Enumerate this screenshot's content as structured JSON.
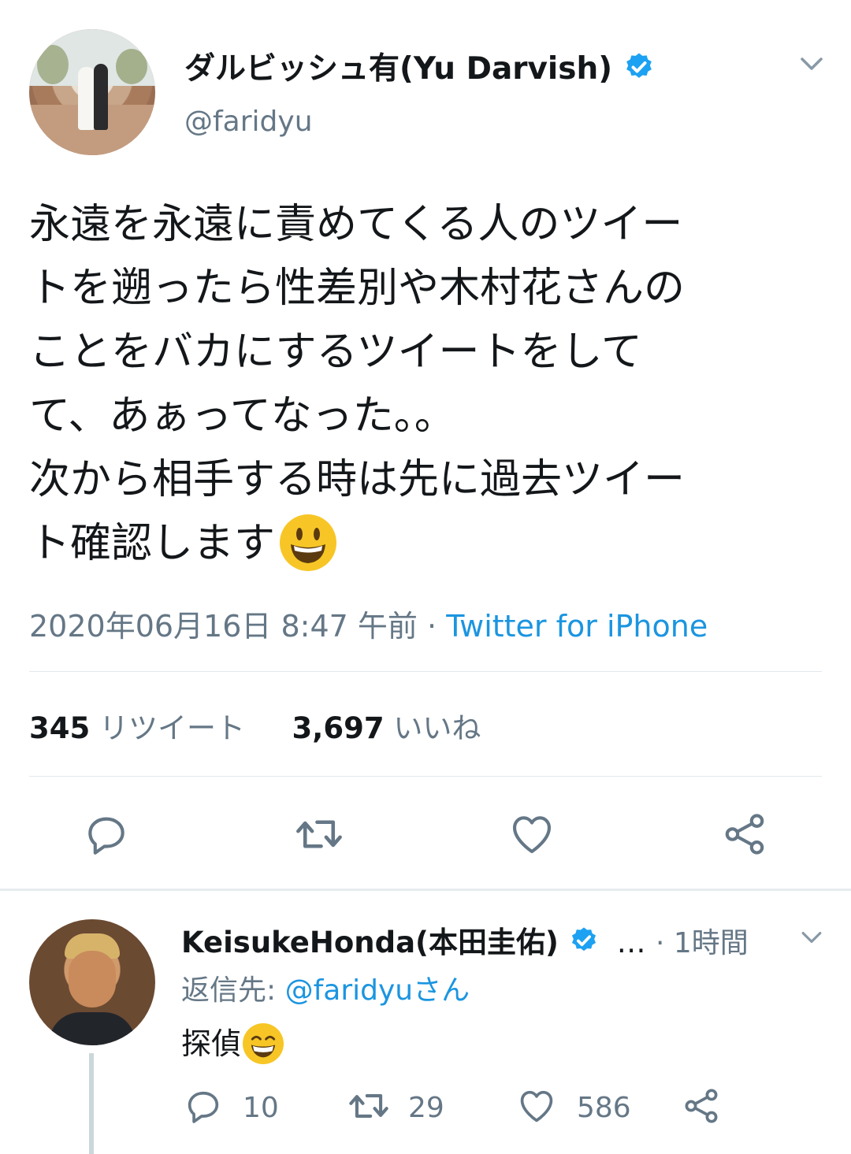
{
  "tweet": {
    "author_name": "ダルビッシュ有(Yu Darvish)",
    "handle": "@faridyu",
    "text_line1": "永遠を永遠に責めてくる人のツイー",
    "text_line2": "トを遡ったら性差別や木村花さんの",
    "text_line3": "ことをバカにするツイートをして",
    "text_line4": "て、あぁってなった。。",
    "text_line5": "次から相手する時は先に過去ツイー",
    "text_line6": "ト確認します",
    "timestamp": "2020年06月16日 8:47 午前",
    "separator": "·",
    "source": "Twitter for iPhone",
    "retweet_count": "345",
    "retweet_label": "リツイート",
    "like_count": "3,697",
    "like_label": "いいね"
  },
  "icons": {
    "verified": "verified-badge-icon",
    "menu": "chevron-down-icon",
    "reply": "reply-icon",
    "retweet": "retweet-icon",
    "like": "heart-icon",
    "share": "share-icon",
    "smiley": "smiley-emoji",
    "grin": "grin-emoji"
  },
  "reply": {
    "author_name": "KeisukeHonda(本田圭佑)",
    "ellipsis": "…",
    "time": "· 1時間",
    "reply_to_prefix": "返信先:",
    "reply_to_handle": "@faridyuさん",
    "text": "探偵",
    "reply_count": "10",
    "retweet_count": "29",
    "like_count": "586"
  },
  "colors": {
    "verified_blue": "#1da1f2",
    "link_blue": "#1b95e0",
    "secondary_text": "#657786",
    "divider": "#e1e8ed",
    "icon_gray": "#657786"
  }
}
